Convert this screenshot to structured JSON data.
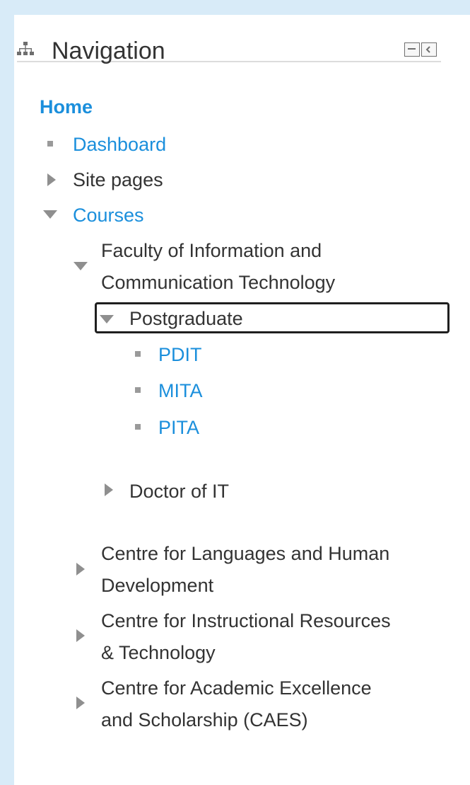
{
  "navigation_block": {
    "title": "Navigation",
    "title_icon": "sitemap-icon",
    "controls": {
      "minimize_icon": "minus-icon",
      "dock_icon": "chevron-left-icon"
    },
    "home": "Home",
    "items": {
      "dashboard": "Dashboard",
      "site_pages": "Site pages",
      "courses": "Courses"
    },
    "faculty": {
      "line1": "Faculty of Information and",
      "line2": "Communication Technology"
    },
    "postgraduate": "Postgraduate",
    "programs": [
      "PDIT",
      "MITA",
      "PITA"
    ],
    "doctor_of_it": "Doctor of IT",
    "centres": [
      {
        "line1": "Centre for Languages and Human",
        "line2": "Development"
      },
      {
        "line1": "Centre for Instructional Resources",
        "line2": "& Technology"
      },
      {
        "line1": "Centre for Academic Excellence",
        "line2": "and Scholarship (CAES)"
      }
    ]
  },
  "colors": {
    "link": "#1b8fdc",
    "text": "#333333",
    "background": "#d8ebf8",
    "panel": "#ffffff"
  }
}
